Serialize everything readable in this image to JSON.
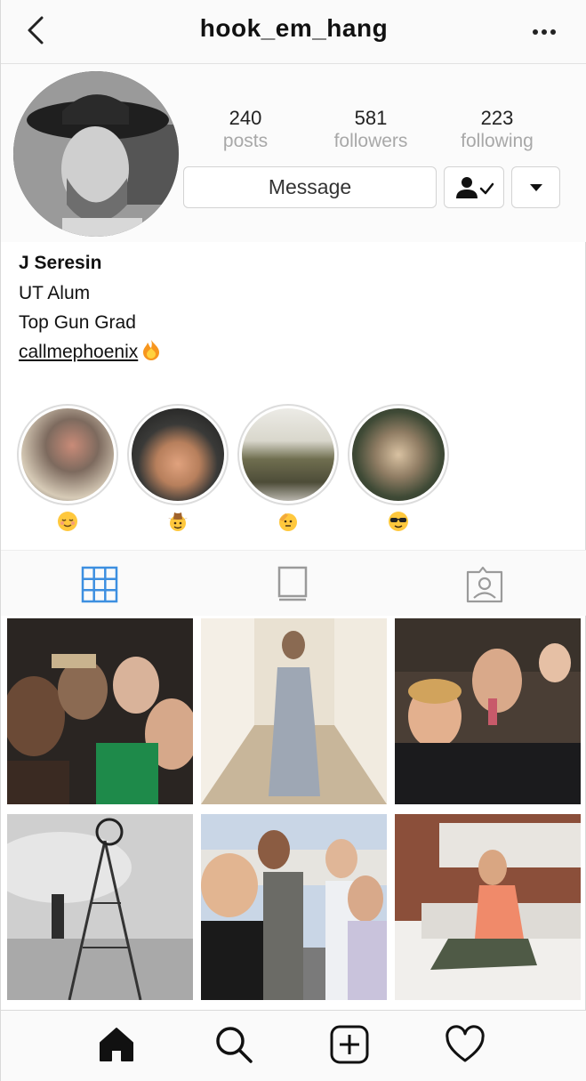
{
  "header": {
    "title": "hook_em_hang",
    "back_icon": "chevron-left-icon",
    "more_icon": "more-horizontal-icon"
  },
  "profile": {
    "stats": [
      {
        "value": "240",
        "label": "posts"
      },
      {
        "value": "581",
        "label": "followers"
      },
      {
        "value": "223",
        "label": "following"
      }
    ],
    "message_label": "Message",
    "following_icon": "user-check-icon",
    "dropdown_icon": "caret-down-icon"
  },
  "bio": {
    "name": "J Seresin",
    "lines": [
      "UT Alum",
      "Top Gun Grad"
    ],
    "link": "callmephoenix",
    "link_emoji": "fire-icon"
  },
  "highlights": [
    {
      "emoji": "relieved-face-icon"
    },
    {
      "emoji": "cowboy-face-icon"
    },
    {
      "emoji": "saluting-face-icon"
    },
    {
      "emoji": "sunglasses-face-icon"
    }
  ],
  "tabs": [
    {
      "icon": "grid-icon",
      "active": true
    },
    {
      "icon": "feed-icon",
      "active": false
    },
    {
      "icon": "tagged-icon",
      "active": false
    }
  ],
  "bottom_nav": [
    {
      "icon": "home-icon"
    },
    {
      "icon": "search-icon"
    },
    {
      "icon": "add-post-icon"
    },
    {
      "icon": "heart-icon"
    }
  ],
  "colors": {
    "active_tab": "#3d8fe0",
    "muted_label": "#a8a8a8",
    "border": "#d3d3d3"
  }
}
